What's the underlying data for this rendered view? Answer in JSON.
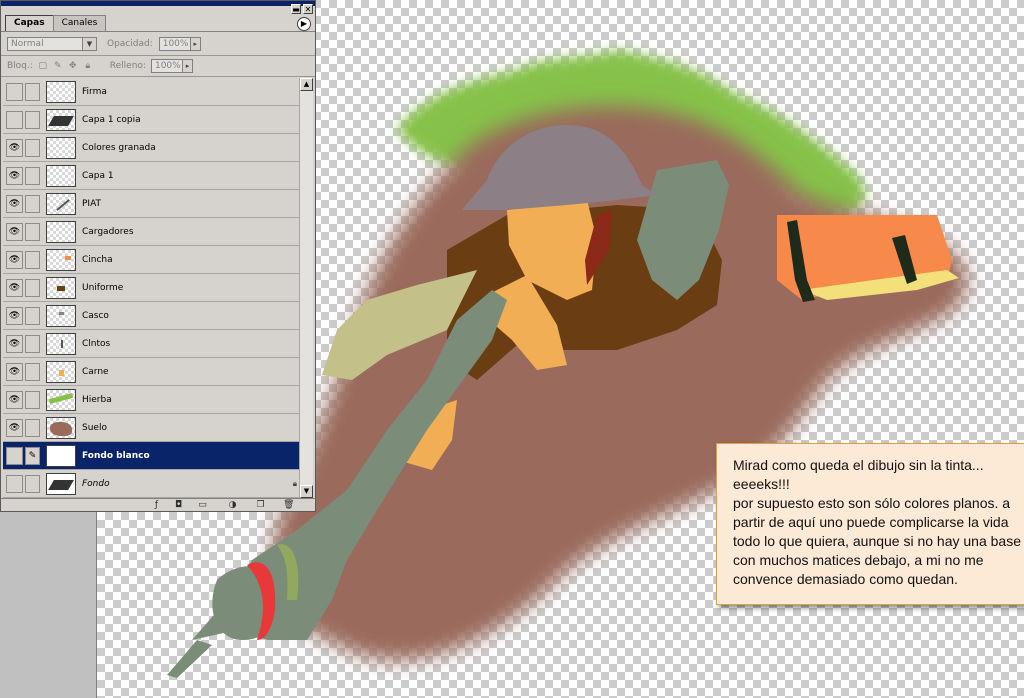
{
  "panel": {
    "tabs": [
      {
        "label": "Capas",
        "active": true
      },
      {
        "label": "Canales",
        "active": false
      }
    ],
    "blend_mode": "Normal",
    "opacity_label": "Opacidad:",
    "opacity_value": "100%",
    "lock_label": "Bloq.:",
    "fill_label": "Relleno:",
    "fill_value": "100%",
    "layers": [
      {
        "name": "Firma",
        "visible": false,
        "selected": false
      },
      {
        "name": "Capa 1 copia",
        "visible": false,
        "selected": false
      },
      {
        "name": "Colores granada",
        "visible": true,
        "selected": false
      },
      {
        "name": "Capa 1",
        "visible": true,
        "selected": false
      },
      {
        "name": "PIAT",
        "visible": true,
        "selected": false
      },
      {
        "name": "Cargadores",
        "visible": true,
        "selected": false
      },
      {
        "name": "Cincha",
        "visible": true,
        "selected": false
      },
      {
        "name": "Uniforme",
        "visible": true,
        "selected": false
      },
      {
        "name": "Casco",
        "visible": true,
        "selected": false
      },
      {
        "name": "Clntos",
        "visible": true,
        "selected": false
      },
      {
        "name": "Carne",
        "visible": true,
        "selected": false
      },
      {
        "name": "Hierba",
        "visible": true,
        "selected": false
      },
      {
        "name": "Suelo",
        "visible": true,
        "selected": false
      },
      {
        "name": "Fondo blanco",
        "visible": false,
        "selected": true
      },
      {
        "name": "Fondo",
        "visible": false,
        "selected": false,
        "locked": true
      }
    ]
  },
  "note": {
    "line1": "Mirad como queda el dibujo sin la tinta...",
    "line2": "eeeeks!!!",
    "line3": "por supuesto esto son sólo colores planos. a partir de aquí uno puede complicarse la vida todo lo que quiera, aunque si no hay una base con muchos matices debajo, a mi no me convence demasiado como quedan."
  },
  "colors": {
    "selection": "#0a246a",
    "panel_bg": "#d6d3ce",
    "ground": "#9a6b5c",
    "grass": "#86c24a",
    "uniform": "#7b8c78",
    "skin": "#f2ae55",
    "helmet": "#8c7f86",
    "dark_brown": "#6b3d12",
    "orange_pack": "#f7894a",
    "note_bg": "#fce9d6"
  }
}
